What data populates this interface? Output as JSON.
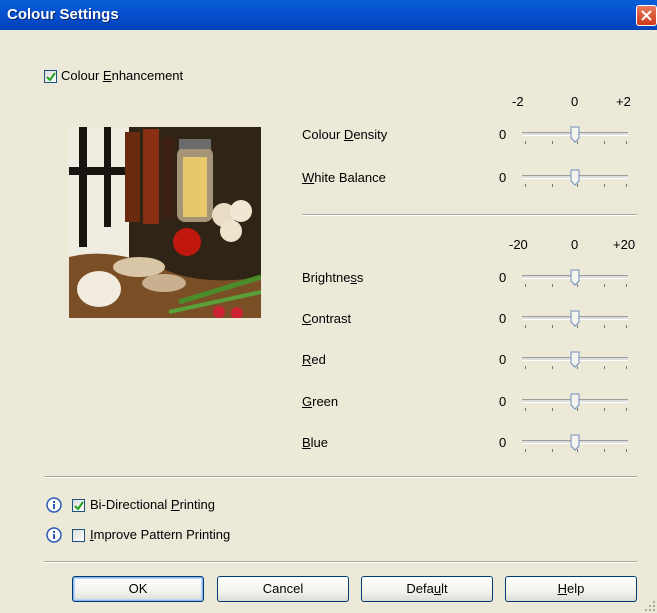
{
  "window": {
    "title": "Colour Settings"
  },
  "colour_enhancement": {
    "label_pre": "Colour ",
    "label_u": "E",
    "label_post": "nhancement",
    "checked": true
  },
  "scale1": {
    "min": "-2",
    "mid": "0",
    "max": "+2"
  },
  "scale2": {
    "min": "-20",
    "mid": "0",
    "max": "+20"
  },
  "sliders": [
    {
      "pre": "Colour ",
      "u": "D",
      "post": "ensity",
      "value": "0"
    },
    {
      "pre": "",
      "u": "W",
      "post": "hite Balance",
      "value": "0"
    },
    {
      "pre": "Brightne",
      "u": "s",
      "post": "s",
      "value": "0"
    },
    {
      "pre": "",
      "u": "C",
      "post": "ontrast",
      "value": "0"
    },
    {
      "pre": "",
      "u": "R",
      "post": "ed",
      "value": "0"
    },
    {
      "pre": "",
      "u": "G",
      "post": "reen",
      "value": "0"
    },
    {
      "pre": "",
      "u": "B",
      "post": "lue",
      "value": "0"
    }
  ],
  "options": [
    {
      "pre": "Bi-Directional ",
      "u": "P",
      "post": "rinting",
      "checked": true
    },
    {
      "pre": "",
      "u": "I",
      "post": "mprove Pattern Printing",
      "checked": false
    }
  ],
  "buttons": {
    "ok": "OK",
    "cancel": "Cancel",
    "default_pre": "Defa",
    "default_u": "u",
    "default_post": "lt",
    "help_u": "H",
    "help_post": "elp"
  },
  "icons": {
    "close": "close-icon",
    "info": "info-icon",
    "check": "checkmark-icon",
    "slider_thumb": "slider-thumb-icon",
    "preview": "sample-photo"
  },
  "colors": {
    "titlebar": "#0650d0",
    "face": "#ece9d8",
    "close": "#cd3a18",
    "check": "#21a121",
    "info": "#2b5ab8"
  }
}
